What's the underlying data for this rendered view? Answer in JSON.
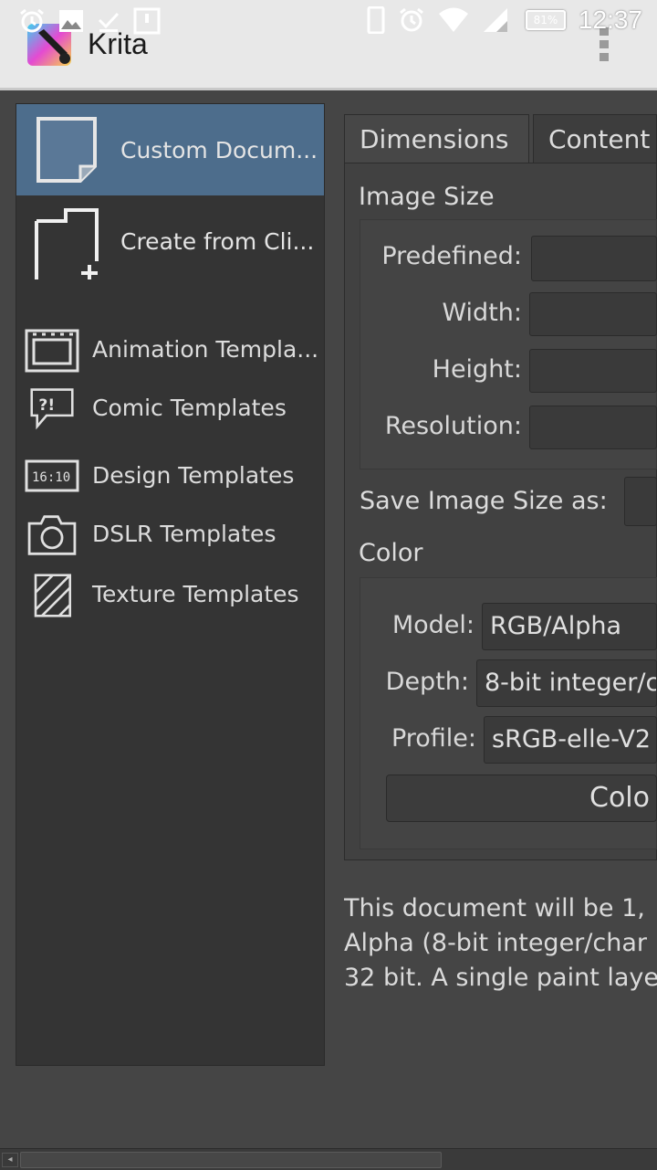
{
  "status_bar": {
    "time": "12:37",
    "battery": "81%"
  },
  "app": {
    "title": "Krita"
  },
  "left_panel": {
    "big_items": [
      {
        "label": "Custom Docum...",
        "selected": true
      },
      {
        "label": "Create from Cli...",
        "selected": false
      }
    ],
    "templates": [
      {
        "label": "Animation Templa..."
      },
      {
        "label": "Comic Templates"
      },
      {
        "label": "Design Templates"
      },
      {
        "label": "DSLR Templates"
      },
      {
        "label": "Texture Templates"
      }
    ]
  },
  "tabs": [
    {
      "label": "Dimensions"
    },
    {
      "label": "Content"
    }
  ],
  "image_size": {
    "title": "Image Size",
    "predefined_label": "Predefined:",
    "width_label": "Width:",
    "height_label": "Height:",
    "resolution_label": "Resolution:",
    "save_label": "Save Image Size as:"
  },
  "color": {
    "title": "Color",
    "model_label": "Model:",
    "model_value": "RGB/Alpha",
    "depth_label": "Depth:",
    "depth_value": "8-bit integer/c",
    "profile_label": "Profile:",
    "profile_value": "sRGB-elle-V2",
    "button_label": "Colo"
  },
  "summary": {
    "line1": "This document will be 1,",
    "line2": "Alpha (8-bit integer/char",
    "line3": "32 bit. A single paint laye"
  }
}
